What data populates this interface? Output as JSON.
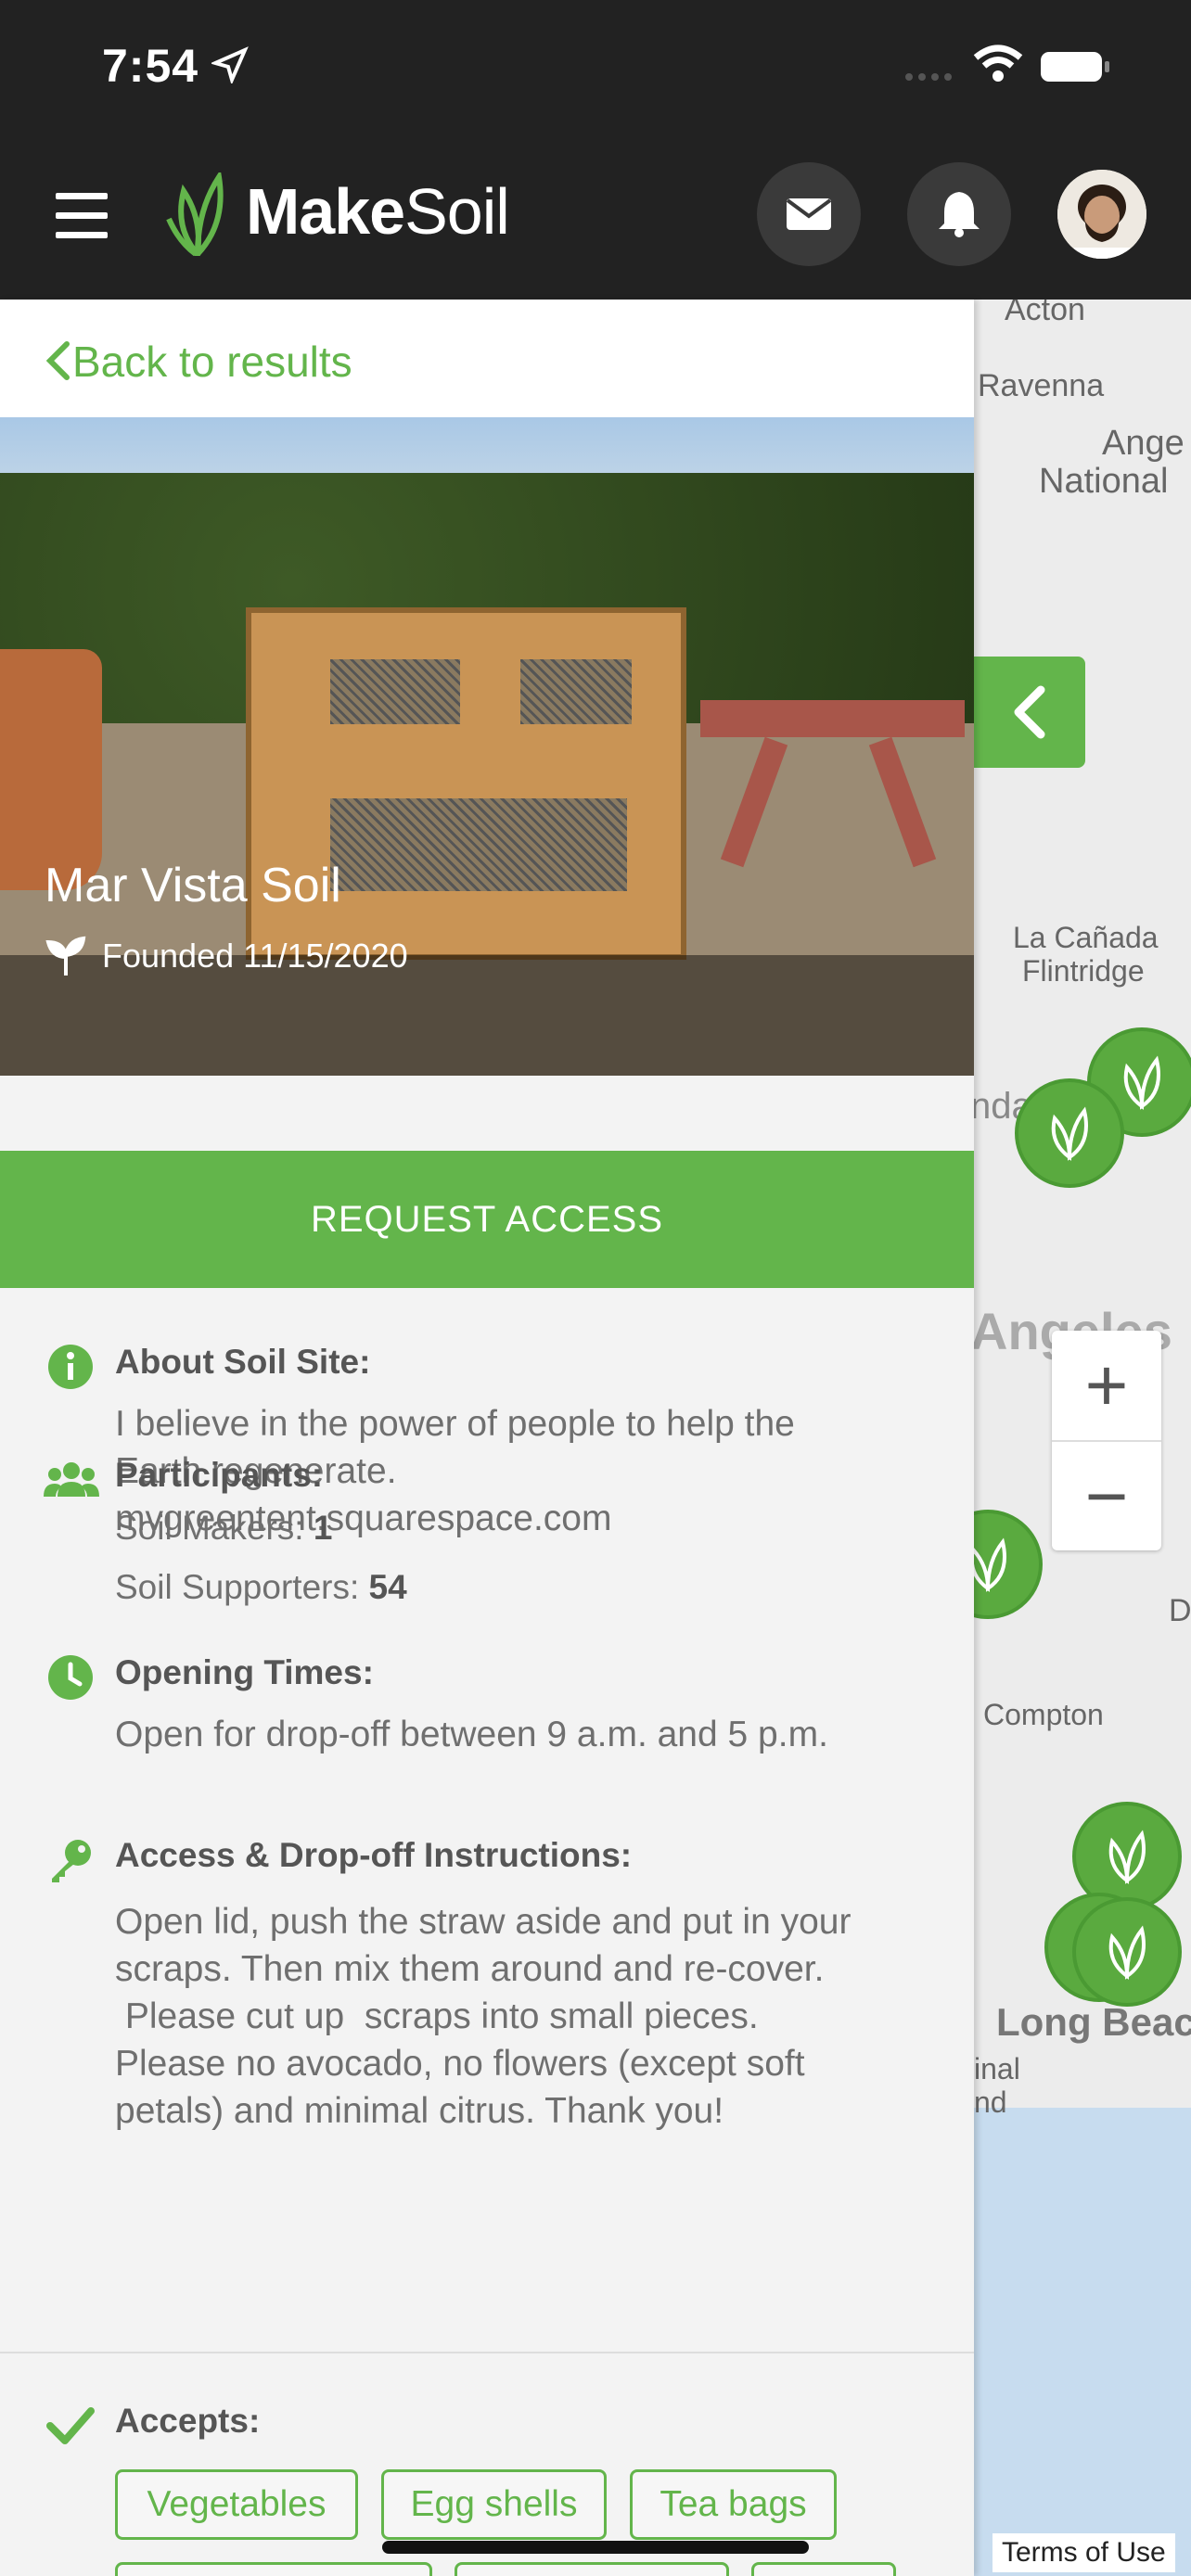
{
  "status_bar": {
    "time": "7:54"
  },
  "app": {
    "name_bold": "Make",
    "name_light": "Soil"
  },
  "header": {
    "menu_icon": "hamburger-icon",
    "messages_icon": "envelope-icon",
    "notifications_icon": "bell-icon"
  },
  "back": {
    "label": "Back to results"
  },
  "site": {
    "name": "Mar Vista Soil",
    "founded": "Founded 11/15/2020"
  },
  "request_access": "REQUEST ACCESS",
  "about": {
    "heading": "About Soil Site:",
    "text_line1": "I believe in the power of people to help the",
    "text_line2": "Earth regenerate.",
    "text_line3": "mvgreentent.squarespace.com"
  },
  "participants": {
    "heading": "Participants:",
    "makers_label": "Soil Makers:",
    "makers_count": "1",
    "supporters_label": "Soil Supporters:",
    "supporters_count": "54"
  },
  "opening": {
    "heading": "Opening Times:",
    "text": "Open for drop-off between 9 a.m. and 5 p.m."
  },
  "instructions": {
    "heading": "Access & Drop-off Instructions:",
    "line1": "Open lid, push the straw aside and put in your",
    "line2": "scraps.  Then mix them around and re-cover.",
    "line3": " Please cut up  scraps into small pieces.",
    "line4": "Please no avocado, no flowers (except soft",
    "line5": "petals) and minimal citrus. Thank you!"
  },
  "accepts": {
    "heading": "Accepts:",
    "items": [
      "Vegetables",
      "Egg shells",
      "Tea bags"
    ]
  },
  "map": {
    "labels": [
      "Acton",
      "Ravenna",
      "Ange",
      "National",
      "La Cañada",
      "Flintridge",
      "nda",
      "Angeles",
      "D",
      "Compton",
      "Long Beac",
      "inal",
      "nd"
    ],
    "zoom_in": "+",
    "zoom_out": "−",
    "terms": "Terms of Use"
  },
  "colors": {
    "brand_green": "#63b54b",
    "header_bg": "#222222",
    "panel_bg": "#f3f3f3"
  }
}
